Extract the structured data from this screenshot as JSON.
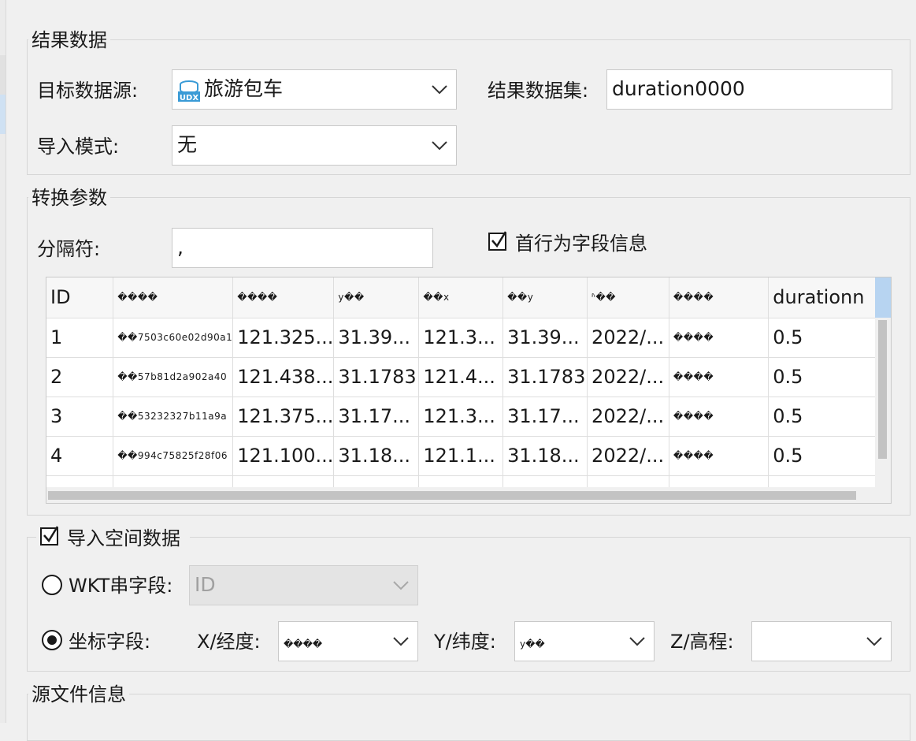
{
  "result": {
    "title": "结果数据",
    "target_source_label": "目标数据源:",
    "target_source_value": "旅游包车",
    "target_source_icon": "udx-datasource-icon",
    "result_dataset_label": "结果数据集:",
    "result_dataset_value": "duration0000",
    "import_mode_label": "导入模式:",
    "import_mode_value": "无"
  },
  "convert": {
    "title": "转换参数",
    "delimiter_label": "分隔符:",
    "delimiter_value": ",",
    "first_row_header_label": "首行为字段信息",
    "first_row_header_checked": true
  },
  "table": {
    "headers": [
      "ID",
      "����",
      "����",
      "y��",
      "��x",
      "��y",
      "ʱ��",
      "����",
      "durationn"
    ],
    "rows": [
      [
        "1",
        "��7503c60e02d90a1",
        "121.325...",
        "31.39...",
        "121.3...",
        "31.39...",
        "2022/...",
        "����",
        "0.5"
      ],
      [
        "2",
        "��57b81d2a902a40",
        "121.438...",
        "31.1783",
        "121.4...",
        "31.1783",
        "2022/...",
        "����",
        "0.5"
      ],
      [
        "3",
        "��53232327b11a9a",
        "121.375...",
        "31.17...",
        "121.3...",
        "31.17...",
        "2022/...",
        "����",
        "0.5"
      ],
      [
        "4",
        "��994c75825f28f06",
        "121.100...",
        "31.18...",
        "121.1...",
        "31.18...",
        "2022/...",
        "����",
        "0.5"
      ]
    ]
  },
  "spatial": {
    "title": "导入空间数据",
    "checked": true,
    "wkt_label": "WKT串字段:",
    "wkt_value": "ID",
    "wkt_selected": false,
    "coord_label": "坐标字段:",
    "coord_selected": true,
    "x_label": "X/经度:",
    "x_value": "����",
    "y_label": "Y/纬度:",
    "y_value": "y��",
    "z_label": "Z/高程:",
    "z_value": ""
  },
  "source": {
    "title": "源文件信息"
  }
}
